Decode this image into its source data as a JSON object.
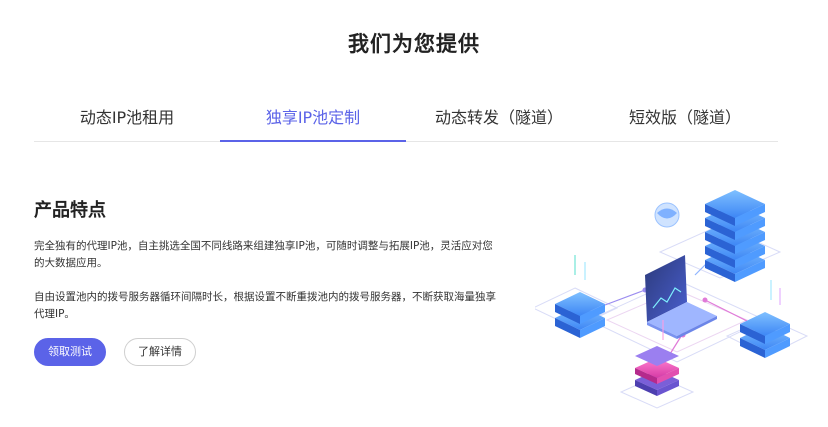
{
  "page_title": "我们为您提供",
  "tabs": [
    {
      "label": "动态IP池租用",
      "active": false
    },
    {
      "label": "独享IP池定制",
      "active": true
    },
    {
      "label": "动态转发（隧道）",
      "active": false
    },
    {
      "label": "短效版（隧道）",
      "active": false
    }
  ],
  "feature": {
    "heading": "产品特点",
    "paragraphs": [
      "完全独有的代理IP池，自主挑选全国不同线路来组建独享IP池，可随时调整与拓展IP池，灵活应对您的大数据应用。",
      "自由设置池内的拨号服务器循环间隔时长，根据设置不断重拨池内的拨号服务器，不断获取海量独享代理IP。"
    ]
  },
  "buttons": {
    "trial": "领取测试",
    "details": "了解详情"
  },
  "colors": {
    "accent": "#5b63e8",
    "server_blue": "#3d86f5",
    "server_pink": "#ff4fb4"
  },
  "icons": {
    "illustration": "server-network-illustration"
  }
}
